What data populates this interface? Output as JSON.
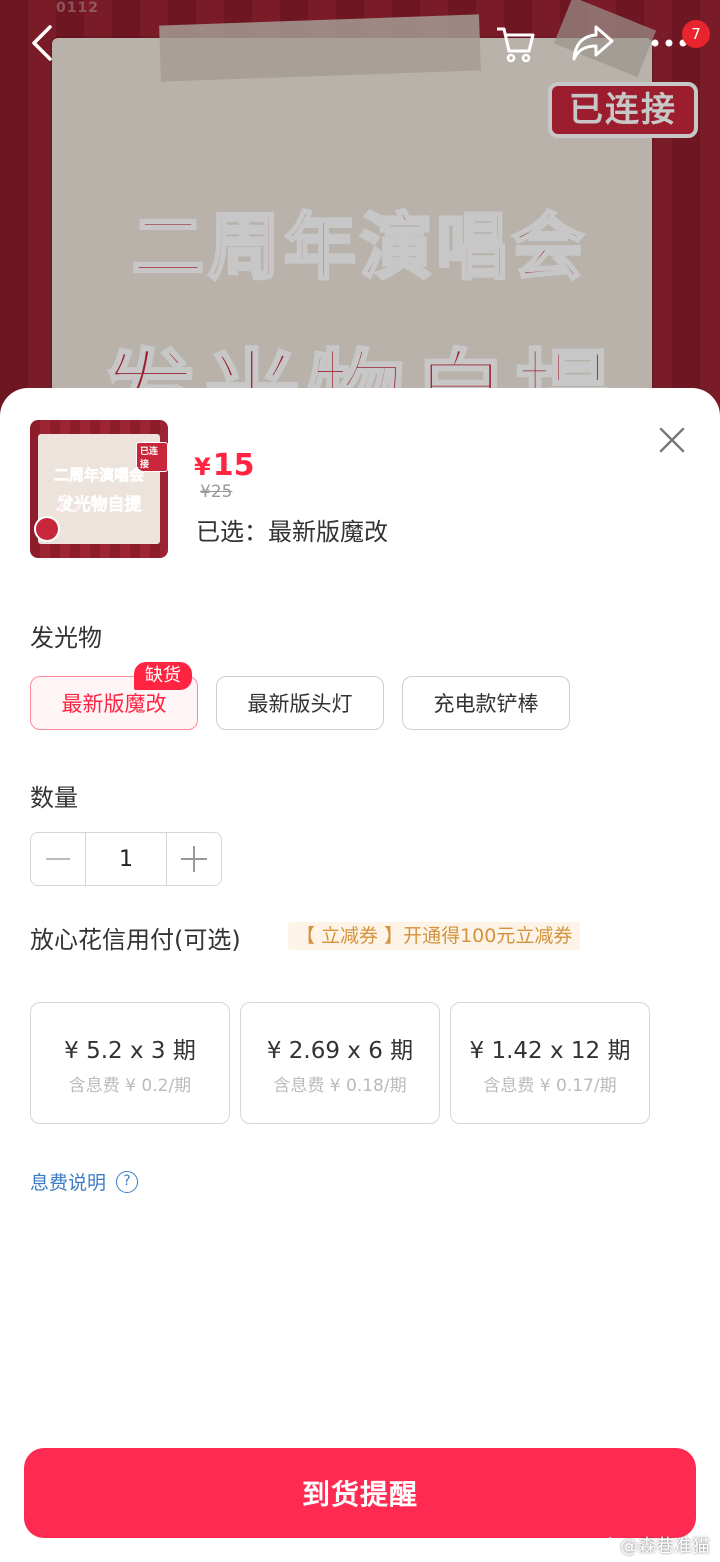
{
  "banner": {
    "code": "0112",
    "connected_tag": "已连接",
    "title_line1": "二周年演唱会",
    "title_line2": "发光物自提"
  },
  "nav": {
    "back_icon": "chevron-left-icon",
    "cart_icon": "cart-icon",
    "share_icon": "share-icon",
    "more_icon": "more-icon",
    "badge_count": "7"
  },
  "product": {
    "currency": "¥",
    "price": "15",
    "original_price": "¥25",
    "selected_label": "已选：",
    "selected_value": "最新版魔改",
    "thumb_tag": "已连接",
    "thumb_title1": "二周年演唱会",
    "thumb_title2": "发光物自提"
  },
  "options": {
    "title": "发光物",
    "items": [
      {
        "label": "最新版魔改",
        "active": true,
        "badge": "缺货"
      },
      {
        "label": "最新版头灯",
        "active": false
      },
      {
        "label": "充电款铲棒",
        "active": false
      }
    ]
  },
  "quantity": {
    "title": "数量",
    "value": "1"
  },
  "payment": {
    "title": "放心花信用付(可选)",
    "promo": "【 立减券 】开通得100元立减券",
    "plans": [
      {
        "main": "¥ 5.2 x 3 期",
        "sub": "含息费 ¥ 0.2/期"
      },
      {
        "main": "¥ 2.69 x 6 期",
        "sub": "含息费 ¥ 0.18/期"
      },
      {
        "main": "¥ 1.42 x 12 期",
        "sub": "含息费 ¥ 0.17/期"
      }
    ],
    "fee_link": "息费说明",
    "help_symbol": "?"
  },
  "cta": {
    "label": "到货提醒"
  },
  "watermark": {
    "text": "@森巷准猫"
  },
  "colors": {
    "accent": "#ff2442",
    "cta": "#ff2a52",
    "link": "#3d7dc4",
    "promo_text": "#d4933c"
  }
}
